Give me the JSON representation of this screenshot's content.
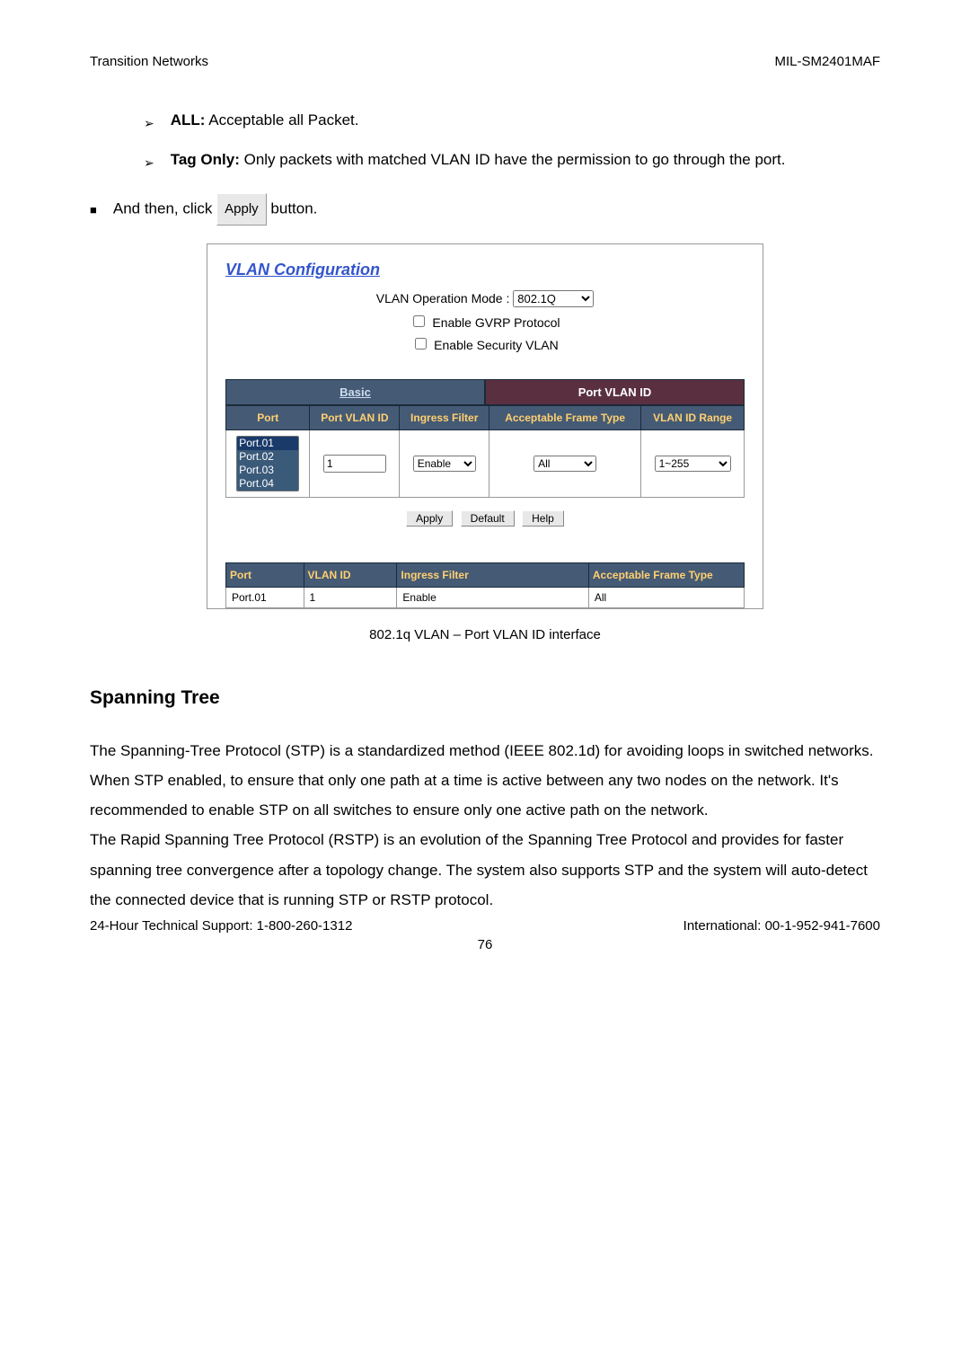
{
  "header": {
    "left": "Transition Networks",
    "right": "MIL-SM2401MAF"
  },
  "bullets": {
    "all": {
      "label": "ALL:",
      "text": " Acceptable all Packet."
    },
    "tagonly": {
      "label": "Tag Only:",
      "text": " Only packets with matched VLAN ID have the permission to go through the port."
    },
    "andthen_pre": "And then, click  ",
    "andthen_btn": "Apply",
    "andthen_post": "  button."
  },
  "vlan": {
    "title": "VLAN Configuration",
    "op_mode_label": "VLAN Operation Mode :",
    "op_mode_value": "802.1Q",
    "gvrp": "Enable GVRP Protocol",
    "security": "Enable Security VLAN",
    "tabs": {
      "basic": "Basic",
      "portvlan": "Port VLAN ID"
    },
    "headers": {
      "port": "Port",
      "pvid": "Port VLAN ID",
      "ingress": "Ingress Filter",
      "accept": "Acceptable Frame Type",
      "range": "VLAN ID Range"
    },
    "ports": [
      "Port.01",
      "Port.02",
      "Port.03",
      "Port.04"
    ],
    "pvid_input": "1",
    "ingress_value": "Enable",
    "accept_value": "All",
    "range_value": "1~255",
    "buttons": {
      "apply": "Apply",
      "default": "Default",
      "help": "Help"
    },
    "result_headers": {
      "port": "Port",
      "vlanid": "VLAN ID",
      "ingress": "Ingress Filter",
      "accept": "Acceptable Frame Type"
    },
    "result_row": {
      "port": "Port.01",
      "vlanid": "1",
      "ingress": "Enable",
      "accept": "All"
    }
  },
  "caption": "802.1q VLAN – Port VLAN ID interface",
  "section_title": "Spanning Tree",
  "body": "The Spanning-Tree Protocol (STP) is a standardized method (IEEE 802.1d) for avoiding loops in switched networks. When STP enabled, to ensure that only one path at a time is active between any two nodes on the network. It's recommended to enable STP on all switches to ensure only one active path on the network.\nThe Rapid Spanning Tree Protocol (RSTP) is an evolution of the Spanning Tree Protocol and provides for faster spanning tree convergence after a topology change. The system also supports STP and the system will auto-detect the connected device that is running STP or RSTP protocol.",
  "footer": {
    "left": "24-Hour Technical Support: 1-800-260-1312",
    "right": "International: 00-1-952-941-7600"
  },
  "page_num": "76"
}
